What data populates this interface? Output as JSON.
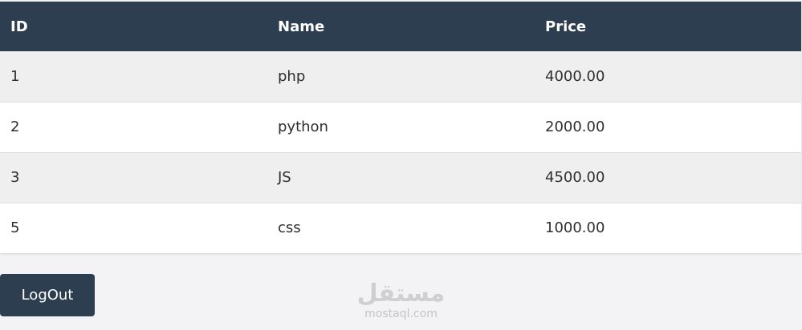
{
  "table": {
    "headers": [
      "ID",
      "Name",
      "Price"
    ],
    "rows": [
      {
        "id": "1",
        "name": "php",
        "price": "4000.00"
      },
      {
        "id": "2",
        "name": "python",
        "price": "2000.00"
      },
      {
        "id": "3",
        "name": "JS",
        "price": "4500.00"
      },
      {
        "id": "5",
        "name": "css",
        "price": "1000.00"
      }
    ]
  },
  "actions": {
    "logout_label": "LogOut"
  },
  "watermark": {
    "arabic": "مستقل",
    "latin": "mostaql.com"
  },
  "colors": {
    "header_bg": "#2c3e50",
    "button_bg": "#2c3e50",
    "page_bg": "#f3f3f6",
    "row_alt_bg": "#efefef"
  }
}
